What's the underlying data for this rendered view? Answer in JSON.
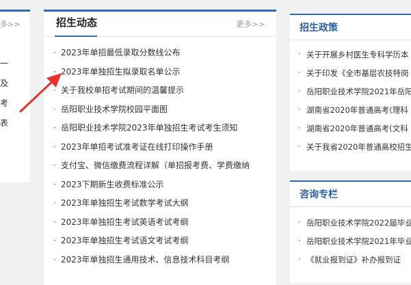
{
  "left": {
    "more": "多>>",
    "items": [
      "一",
      "及",
      "考",
      "表"
    ]
  },
  "center": {
    "title": "招生动态",
    "more": "更多>>",
    "items": [
      "2023年单招最低录取分数线公布",
      "2023年单独招生拟录取名单公示",
      "关于我校单招考试期间的温馨提示",
      "岳阳职业技术学院校园平面图",
      "岳阳职业技术学院2023年单独招生考试考生须知",
      "2023年单招考试准考证在线打印操作手册",
      "支付宝、微信缴费流程详解（单招报考费、学费缴纳",
      "2023下期新生收费标准公示",
      "2023年单独招生考试数学考试大纲",
      "2023年单独招生考试英语考试考纲",
      "2023年单独招生考试语文考试考纲",
      "2023年单独招生通用技术、信息技术科目考纲"
    ]
  },
  "policy": {
    "title": "招生政策",
    "items": [
      "关于开展乡村医生专科学历本",
      "关于印发《全市基层农技特岗",
      "岳阳职业技术学院2021年岳阳",
      "湖南省2020年普通高考(理科",
      "湖南省2020年普通高考(文科",
      "关于我省2020年普通高校招生"
    ]
  },
  "consult": {
    "title": "咨询专栏",
    "items": [
      "岳阳职业技术学院2022届毕业",
      "岳阳职业技术学院2021年毕业",
      "《就业报到证》补办报到证"
    ]
  },
  "colors": {
    "accent": "#3068b5",
    "arrow": "#e8312a"
  }
}
